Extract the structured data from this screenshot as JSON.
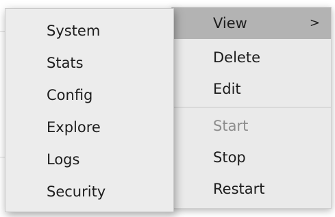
{
  "submenu": {
    "items": [
      {
        "label": "System"
      },
      {
        "label": "Stats"
      },
      {
        "label": "Config"
      },
      {
        "label": "Explore"
      },
      {
        "label": "Logs"
      },
      {
        "label": "Security"
      }
    ]
  },
  "context_menu": {
    "items": [
      {
        "label": "View",
        "state": "highlighted",
        "has_submenu": true,
        "arrow": ">"
      },
      {
        "label": "Delete",
        "state": "enabled"
      },
      {
        "label": "Edit",
        "state": "enabled"
      },
      {
        "label": "Start",
        "state": "disabled"
      },
      {
        "label": "Stop",
        "state": "enabled"
      },
      {
        "label": "Restart",
        "state": "enabled"
      }
    ]
  },
  "colors": {
    "menu_background": "#ececec",
    "highlight": "#b3b3b3",
    "text": "#1d1d1d",
    "disabled_text": "#8d8d8d"
  }
}
